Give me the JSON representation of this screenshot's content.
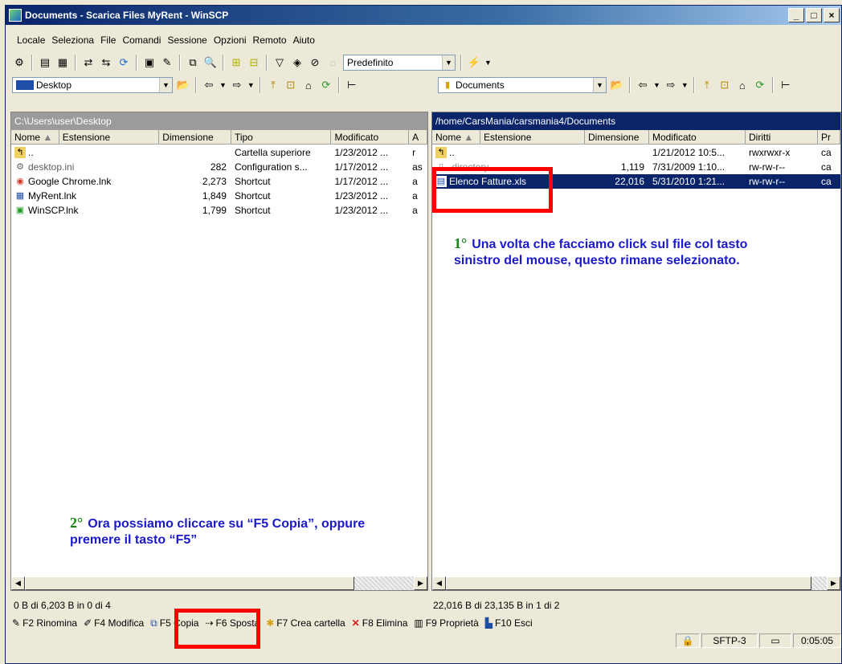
{
  "window": {
    "title": "Documents - Scarica Files MyRent - WinSCP",
    "min": "_",
    "max": "□",
    "close": "×"
  },
  "menu": [
    "Locale",
    "Seleziona",
    "File",
    "Comandi",
    "Sessione",
    "Opzioni",
    "Remoto",
    "Aiuto"
  ],
  "toolbar": {
    "profile_combo": "Predefinito"
  },
  "left": {
    "location": "Desktop",
    "path": "C:\\Users\\user\\Desktop",
    "columns": [
      "Nome",
      "Estensione",
      "Dimensione",
      "Tipo",
      "Modificato",
      "A"
    ],
    "rows": [
      {
        "name": "..",
        "size": "",
        "type": "Cartella superiore",
        "modified": "1/23/2012 ...",
        "attr": "r"
      },
      {
        "name": "desktop.ini",
        "size": "282",
        "type": "Configuration s...",
        "modified": "1/17/2012 ...",
        "attr": "as"
      },
      {
        "name": "Google Chrome.lnk",
        "size": "2,273",
        "type": "Shortcut",
        "modified": "1/17/2012 ...",
        "attr": "a"
      },
      {
        "name": "MyRent.lnk",
        "size": "1,849",
        "type": "Shortcut",
        "modified": "1/23/2012 ...",
        "attr": "a"
      },
      {
        "name": "WinSCP.lnk",
        "size": "1,799",
        "type": "Shortcut",
        "modified": "1/23/2012 ...",
        "attr": "a"
      }
    ],
    "status": "0 B di 6,203 B in 0 di 4"
  },
  "right": {
    "location": "Documents",
    "path": "/home/CarsMania/carsmania4/Documents",
    "columns": [
      "Nome",
      "Estensione",
      "Dimensione",
      "Modificato",
      "Diritti",
      "Pr"
    ],
    "rows": [
      {
        "name": "..",
        "size": "",
        "modified": "1/21/2012 10:5...",
        "rights": "rwxrwxr-x",
        "owner": "ca"
      },
      {
        "name": ".directory",
        "size": "1,119",
        "modified": "7/31/2009 1:10...",
        "rights": "rw-rw-r--",
        "owner": "ca"
      },
      {
        "name": "Elenco Fatture.xls",
        "size": "22,016",
        "modified": "5/31/2010 1:21...",
        "rights": "rw-rw-r--",
        "owner": "ca"
      }
    ],
    "status": "22,016 B di 23,135 B in 1 di 2"
  },
  "fkeys": [
    "F2 Rinomina",
    "F4 Modifica",
    "F5 Copia",
    "F6 Sposta",
    "F7 Crea cartella",
    "F8 Elimina",
    "F9 Proprietà",
    "F10 Esci"
  ],
  "statusbar": {
    "protocol": "SFTP-3",
    "time": "0:05:05"
  },
  "annotations": {
    "first_num": "1°",
    "first_text": "Una volta che facciamo click sul file col tasto sinistro del mouse, questo rimane selezionato.",
    "second_num": "2°",
    "second_text": "Ora possiamo cliccare su “F5 Copia”, oppure premere il tasto “F5”"
  },
  "colors": {
    "selection": "#0a246a",
    "annotation_text": "#1a1ac8",
    "annotation_number": "#148214",
    "highlight_box": "#ff0000"
  }
}
